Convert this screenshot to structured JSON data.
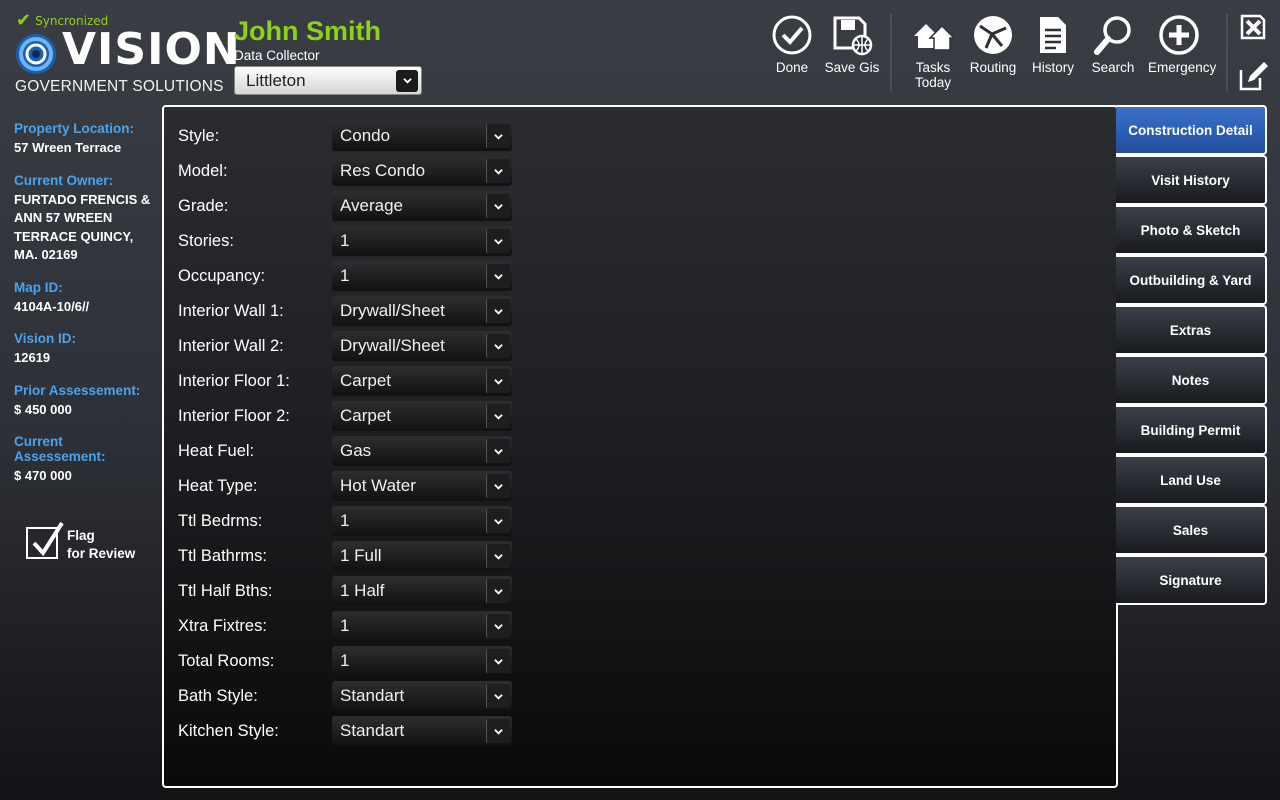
{
  "header": {
    "sync_status": "Syncronized",
    "logo": {
      "word": "VISION",
      "sub": "GOVERNMENT SOLUTIONS"
    },
    "user_name": "John Smith",
    "user_role": "Data Collector",
    "town_select": {
      "value": "Littleton"
    }
  },
  "toolbar": {
    "done": "Done",
    "save_gis": "Save Gis",
    "tasks_today_1": "Tasks",
    "tasks_today_2": "Today",
    "routing": "Routing",
    "history": "History",
    "search": "Search",
    "emergency": "Emergency"
  },
  "property": {
    "location_label": "Property Location:",
    "location": "57 Wreen Terrace",
    "owner_label": "Current Owner:",
    "owner": "FURTADO FRENCIS & ANN 57 WREEN TERRACE QUINCY, MA. 02169",
    "map_id_label": "Map ID:",
    "map_id": "4104A-10/6//",
    "vision_id_label": "Vision ID:",
    "vision_id": "12619",
    "prior_label": "Prior Assessement:",
    "prior": "$ 450 000",
    "current_label": "Current Assessement:",
    "current": "$ 470 000",
    "flag_line1": "Flag",
    "flag_line2": "for Review"
  },
  "form": {
    "fields": [
      {
        "label": "Style:",
        "value": "Condo"
      },
      {
        "label": "Model:",
        "value": "Res Condo"
      },
      {
        "label": "Grade:",
        "value": "Average"
      },
      {
        "label": "Stories:",
        "value": "1"
      },
      {
        "label": "Occupancy:",
        "value": "1"
      },
      {
        "label": "Interior Wall 1:",
        "value": "Drywall/Sheet"
      },
      {
        "label": "Interior Wall 2:",
        "value": "Drywall/Sheet"
      },
      {
        "label": "Interior Floor 1:",
        "value": "Carpet"
      },
      {
        "label": "Interior Floor 2:",
        "value": "Carpet"
      },
      {
        "label": "Heat Fuel:",
        "value": "Gas"
      },
      {
        "label": "Heat Type:",
        "value": "Hot Water"
      },
      {
        "label": "Ttl Bedrms:",
        "value": "1"
      },
      {
        "label": "Ttl Bathrms:",
        "value": "1 Full"
      },
      {
        "label": "Ttl Half Bths:",
        "value": "1 Half"
      },
      {
        "label": "Xtra Fixtres:",
        "value": "1"
      },
      {
        "label": "Total Rooms:",
        "value": "1"
      },
      {
        "label": "Bath Style:",
        "value": "Standart"
      },
      {
        "label": "Kitchen Style:",
        "value": "Standart"
      }
    ]
  },
  "tabs": [
    {
      "label": "Construction Detail",
      "active": true
    },
    {
      "label": "Visit History"
    },
    {
      "label": "Photo & Sketch"
    },
    {
      "label": "Outbuilding & Yard"
    },
    {
      "label": "Extras"
    },
    {
      "label": "Notes"
    },
    {
      "label": "Building Permit"
    },
    {
      "label": "Land Use"
    },
    {
      "label": "Sales"
    },
    {
      "label": "Signature"
    }
  ],
  "colors": {
    "accent_green": "#8ed11b",
    "label_blue": "#4aa3ee",
    "active_tab": "#2d5fb6"
  },
  "icons": [
    "check-icon",
    "vision-logo-icon",
    "chevron-down-icon",
    "done-icon",
    "save-gis-icon",
    "tasks-today-icon",
    "routing-icon",
    "history-icon",
    "search-icon",
    "emergency-icon",
    "close-icon",
    "edit-icon",
    "checkbox-checked-icon"
  ]
}
